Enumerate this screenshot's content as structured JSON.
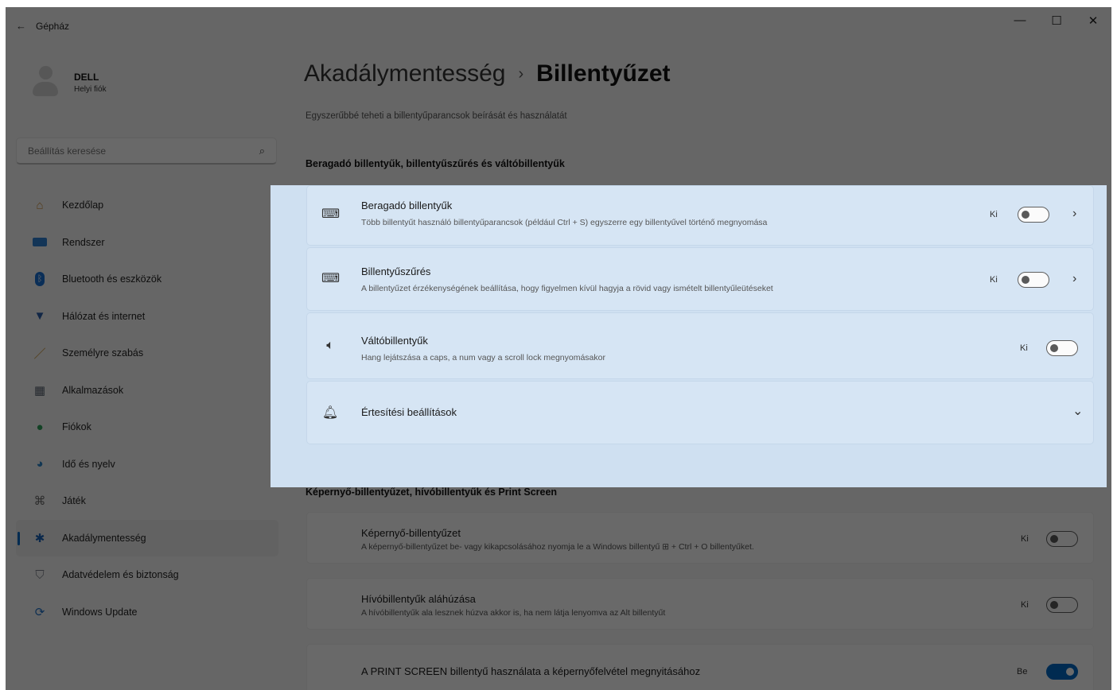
{
  "window": {
    "app_title": "Gépház",
    "back_icon": "back-arrow-icon",
    "controls": {
      "minimize": "—",
      "maximize": "☐",
      "close": "✕"
    }
  },
  "profile": {
    "name": "DELL",
    "subtitle": "Helyi fiók"
  },
  "search": {
    "placeholder": "Beállítás keresése",
    "icon": "search-icon"
  },
  "nav": {
    "items": [
      {
        "label": "Kezdőlap",
        "icon": "home-icon",
        "color": "#c88a3a"
      },
      {
        "label": "Rendszer",
        "icon": "system-icon",
        "color": "#2f7fd0"
      },
      {
        "label": "Bluetooth és eszközök",
        "icon": "bluetooth-icon",
        "color": "#1a6fd0"
      },
      {
        "label": "Hálózat és internet",
        "icon": "wifi-icon",
        "color": "#2d5ea8"
      },
      {
        "label": "Személyre szabás",
        "icon": "brush-icon",
        "color": "#c48b2a"
      },
      {
        "label": "Alkalmazások",
        "icon": "apps-icon",
        "color": "#5a6270"
      },
      {
        "label": "Fiókok",
        "icon": "account-icon",
        "color": "#2f9e5a"
      },
      {
        "label": "Idő és nyelv",
        "icon": "globe-clock-icon",
        "color": "#2b83c6"
      },
      {
        "label": "Játék",
        "icon": "gamepad-icon",
        "color": "#6a6a6a"
      },
      {
        "label": "Akadálymentesség",
        "icon": "accessibility-icon",
        "color": "#1a5fb4",
        "active": true
      },
      {
        "label": "Adatvédelem és biztonság",
        "icon": "shield-icon",
        "color": "#7a7f88"
      },
      {
        "label": "Windows Update",
        "icon": "update-icon",
        "color": "#1f6fc4"
      }
    ]
  },
  "main": {
    "breadcrumb_parent": "Akadálymentesség",
    "breadcrumb_sep": "›",
    "breadcrumb_current": "Billentyűzet",
    "subtitle": "Egyszerűbbé teheti a billentyűparancsok beírását és használatát",
    "section1": "Beragadó billentyűk, billentyűszűrés és váltóbillentyűk",
    "section2": "Képernyő-billentyűzet, hívóbillentyűk és Print Screen",
    "cards1": [
      {
        "title": "Beragadó billentyűk",
        "desc": "Több billentyűt használó billentyűparancsok (például Ctrl + S) egyszerre egy billentyűvel történő megnyomása",
        "state": "Ki",
        "on": false,
        "chevron": "›",
        "icon": "sticky-keys-icon"
      },
      {
        "title": "Billentyűszűrés",
        "desc": "A billentyűzet érzékenységének beállítása, hogy figyelmen kívül hagyja a rövid vagy ismételt billentyűleütéseket",
        "state": "Ki",
        "on": false,
        "chevron": "›",
        "icon": "filter-keys-icon"
      },
      {
        "title": "Váltóbillentyűk",
        "desc": "Hang lejátszása a caps, a num vagy a scroll lock megnyomásakor",
        "state": "Ki",
        "on": false,
        "icon": "speaker-icon"
      },
      {
        "title": "Értesítési beállítások",
        "chevron": "⌄",
        "icon": "bell-icon"
      }
    ],
    "cards2": [
      {
        "title": "Képernyő-billentyűzet",
        "desc": "A képernyő-billentyűzet be- vagy kikapcsolásához nyomja le a Windows billentyű ⊞ + Ctrl + O billentyűket.",
        "state": "Ki",
        "on": false
      },
      {
        "title": "Hívóbillentyűk aláhúzása",
        "desc": "A hívóbillentyűk ala lesznek húzva akkor is, ha nem látja lenyomva az Alt billentyűt",
        "state": "Ki",
        "on": false
      },
      {
        "title": "A PRINT SCREEN billentyű használata a képernyőfelvétel megnyitásához",
        "state": "Be",
        "on": true
      }
    ]
  },
  "colors": {
    "accent": "#0067c0",
    "highlight": "#cfe0f1"
  }
}
